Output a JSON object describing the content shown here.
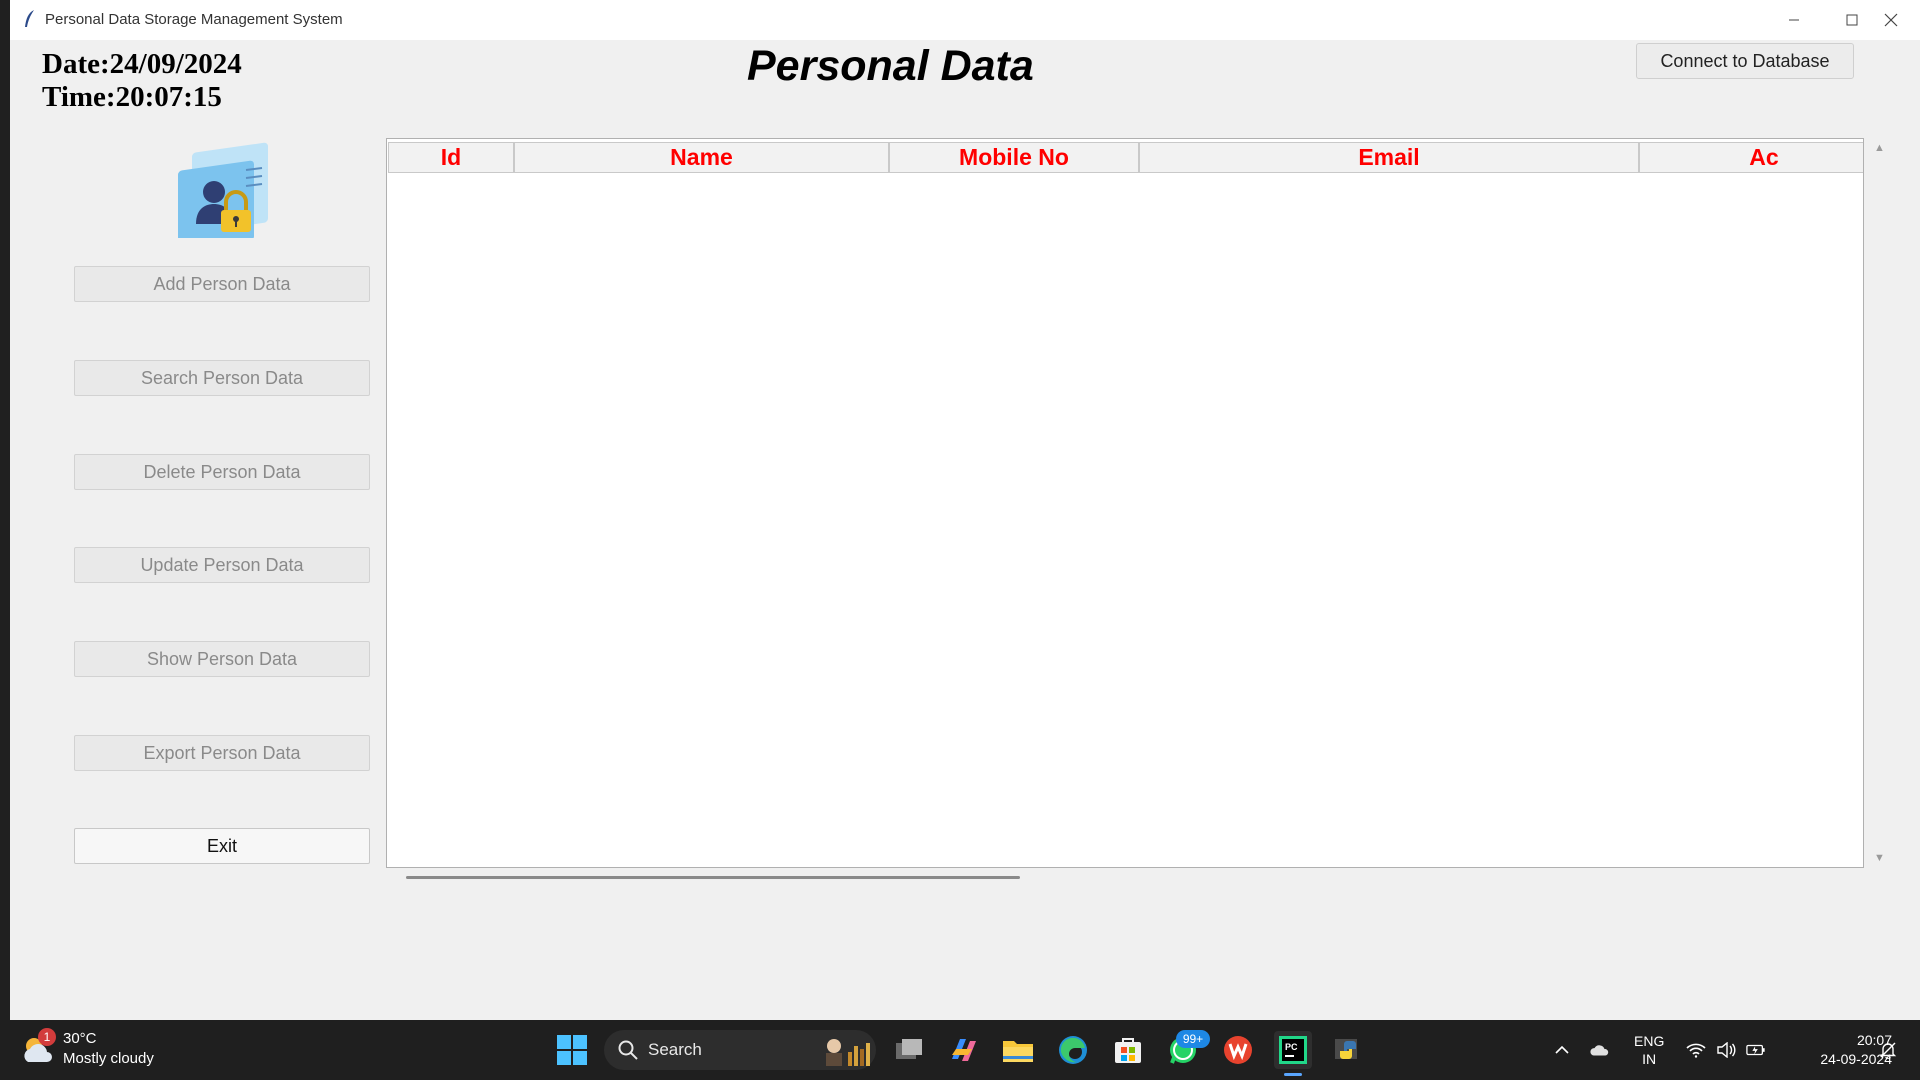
{
  "window": {
    "title": "Personal Data Storage Management System"
  },
  "header": {
    "date_label": "Date:",
    "date_value": "24/09/2024",
    "time_label": "Time:",
    "time_value": "20:07:15",
    "title": "Personal Data",
    "connect_label": "Connect to Database"
  },
  "sidebar": {
    "buttons": [
      {
        "label": "Add Person Data",
        "enabled": false
      },
      {
        "label": "Search Person Data",
        "enabled": false
      },
      {
        "label": "Delete Person Data",
        "enabled": false
      },
      {
        "label": "Update Person Data",
        "enabled": false
      },
      {
        "label": "Show Person Data",
        "enabled": false
      },
      {
        "label": "Export Person Data",
        "enabled": false
      },
      {
        "label": "Exit",
        "enabled": true
      }
    ]
  },
  "table": {
    "columns": [
      "Id",
      "Name",
      "Mobile No",
      "Email",
      "Ac"
    ],
    "header_color": "#ff0000",
    "rows": []
  },
  "taskbar": {
    "weather_badge": "1",
    "temperature": "30°C",
    "condition": "Mostly cloudy",
    "search_label": "Search",
    "whatsapp_badge": "99+",
    "lang_primary": "ENG",
    "lang_secondary": "IN",
    "clock_time": "20:07",
    "clock_date": "24-09-2024",
    "apps": [
      "task-view-icon",
      "copilot-icon",
      "file-explorer-icon",
      "edge-icon",
      "store-icon",
      "whatsapp-icon",
      "wps-office-icon",
      "pycharm-icon",
      "python-icon"
    ]
  }
}
